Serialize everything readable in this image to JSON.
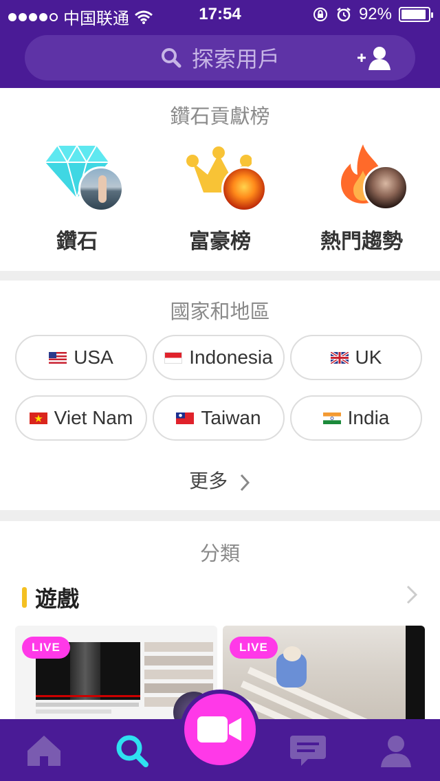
{
  "status_bar": {
    "carrier": "中国联通",
    "time": "17:54",
    "battery": "92%",
    "battery_level": 0.92
  },
  "search": {
    "placeholder": "探索用戶"
  },
  "ranking": {
    "title": "鑽石貢獻榜",
    "items": [
      {
        "label": "鑽石",
        "icon": "diamond-icon"
      },
      {
        "label": "富豪榜",
        "icon": "crown-icon"
      },
      {
        "label": "熱門趨勢",
        "icon": "flame-icon"
      }
    ]
  },
  "countries": {
    "title": "國家和地區",
    "items": [
      {
        "label": "USA",
        "flag": "us-flag-icon"
      },
      {
        "label": "Indonesia",
        "flag": "indonesia-flag-icon"
      },
      {
        "label": "UK",
        "flag": "uk-flag-icon"
      },
      {
        "label": "Viet Nam",
        "flag": "vietnam-flag-icon"
      },
      {
        "label": "Taiwan",
        "flag": "taiwan-flag-icon"
      },
      {
        "label": "India",
        "flag": "india-flag-icon"
      }
    ],
    "more_label": "更多"
  },
  "categories": {
    "title": "分類",
    "group_name": "遊戲",
    "badge": "LIVE"
  },
  "colors": {
    "header_purple": "#4a1b96",
    "accent_pink": "#ff39e8",
    "active_tab_cyan": "#2fe0f0",
    "category_yellow": "#f4c022"
  },
  "tab_bar": {
    "tabs": [
      "home-icon",
      "search-icon",
      "video-camera-icon",
      "chat-icon",
      "profile-icon"
    ],
    "active": "search-icon"
  }
}
